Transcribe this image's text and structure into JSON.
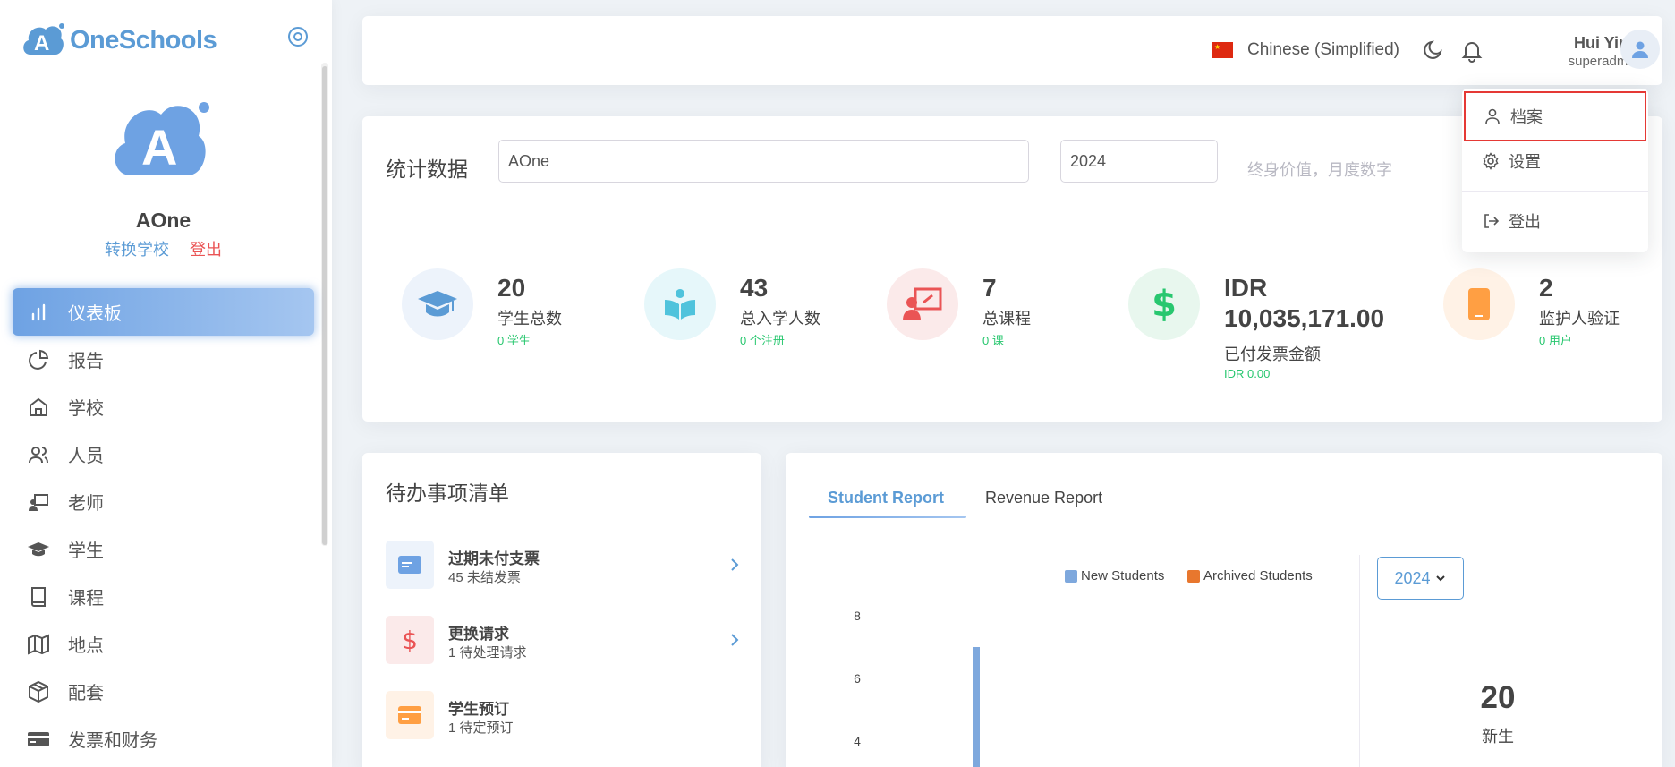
{
  "brand": {
    "name": "OneSchools"
  },
  "school": {
    "name": "AOne",
    "switch_label": "转换学校",
    "logout_label": "登出"
  },
  "nav": [
    {
      "label": "仪表板",
      "icon": "chart-bars-icon",
      "active": true
    },
    {
      "label": "报告",
      "icon": "pie-chart-icon"
    },
    {
      "label": "学校",
      "icon": "home-icon"
    },
    {
      "label": "人员",
      "icon": "users-icon"
    },
    {
      "label": "老师",
      "icon": "teacher-icon"
    },
    {
      "label": "学生",
      "icon": "graduation-cap-icon"
    },
    {
      "label": "课程",
      "icon": "book-icon"
    },
    {
      "label": "地点",
      "icon": "map-icon"
    },
    {
      "label": "配套",
      "icon": "package-icon"
    },
    {
      "label": "发票和财务",
      "icon": "credit-card-icon"
    }
  ],
  "header": {
    "language": "Chinese (Simplified)",
    "user_name": "Hui Ying",
    "user_role": "superadmin"
  },
  "user_menu": {
    "profile": "档案",
    "settings": "设置",
    "logout": "登出"
  },
  "stats": {
    "title": "统计数据",
    "school_value": "AOne",
    "year_value": "2024",
    "subtitle": "终身价值，月度数字",
    "items": [
      {
        "value": "20",
        "label": "学生总数",
        "sub": "0 学生",
        "icon": "graduation-cap-icon",
        "color": "#5b9bd5"
      },
      {
        "value": "43",
        "label": "总入学人数",
        "sub": "0 个注册",
        "icon": "open-book-icon",
        "color": "#4fc3dc"
      },
      {
        "value": "7",
        "label": "总课程",
        "sub": "0 课",
        "icon": "teacher-board-icon",
        "color": "#ea5455"
      },
      {
        "value": "IDR 10,035,171.00",
        "value_line1": "IDR",
        "value_line2": "10,035,171.00",
        "label": "已付发票金额",
        "sub": "IDR 0.00",
        "icon": "dollar-icon",
        "color": "#28c76f"
      },
      {
        "value": "2",
        "label": "监护人验证",
        "sub": "0 用户",
        "icon": "mobile-icon",
        "color": "#ff9f43"
      }
    ]
  },
  "todo": {
    "title": "待办事项清单",
    "items": [
      {
        "title": "过期未付支票",
        "sub": "45 未结发票",
        "icon": "card-icon"
      },
      {
        "title": "更换请求",
        "sub": "1 待处理请求",
        "icon": "dollar-icon"
      },
      {
        "title": "学生预订",
        "sub": "1 待定预订",
        "icon": "credit-card-icon"
      }
    ]
  },
  "report": {
    "tabs": [
      "Student Report",
      "Revenue Report"
    ],
    "year": "2024",
    "new_students_count": "20",
    "new_students_label": "新生"
  },
  "chart_data": {
    "type": "bar",
    "series": [
      {
        "name": "New Students",
        "color": "#7ea8dd",
        "values": [
          0,
          7
        ]
      },
      {
        "name": "Archived Students",
        "color": "#e8772e",
        "values": [
          0,
          0
        ]
      }
    ],
    "yticks": [
      "8",
      "6",
      "4"
    ],
    "ylim": [
      0,
      8
    ]
  }
}
